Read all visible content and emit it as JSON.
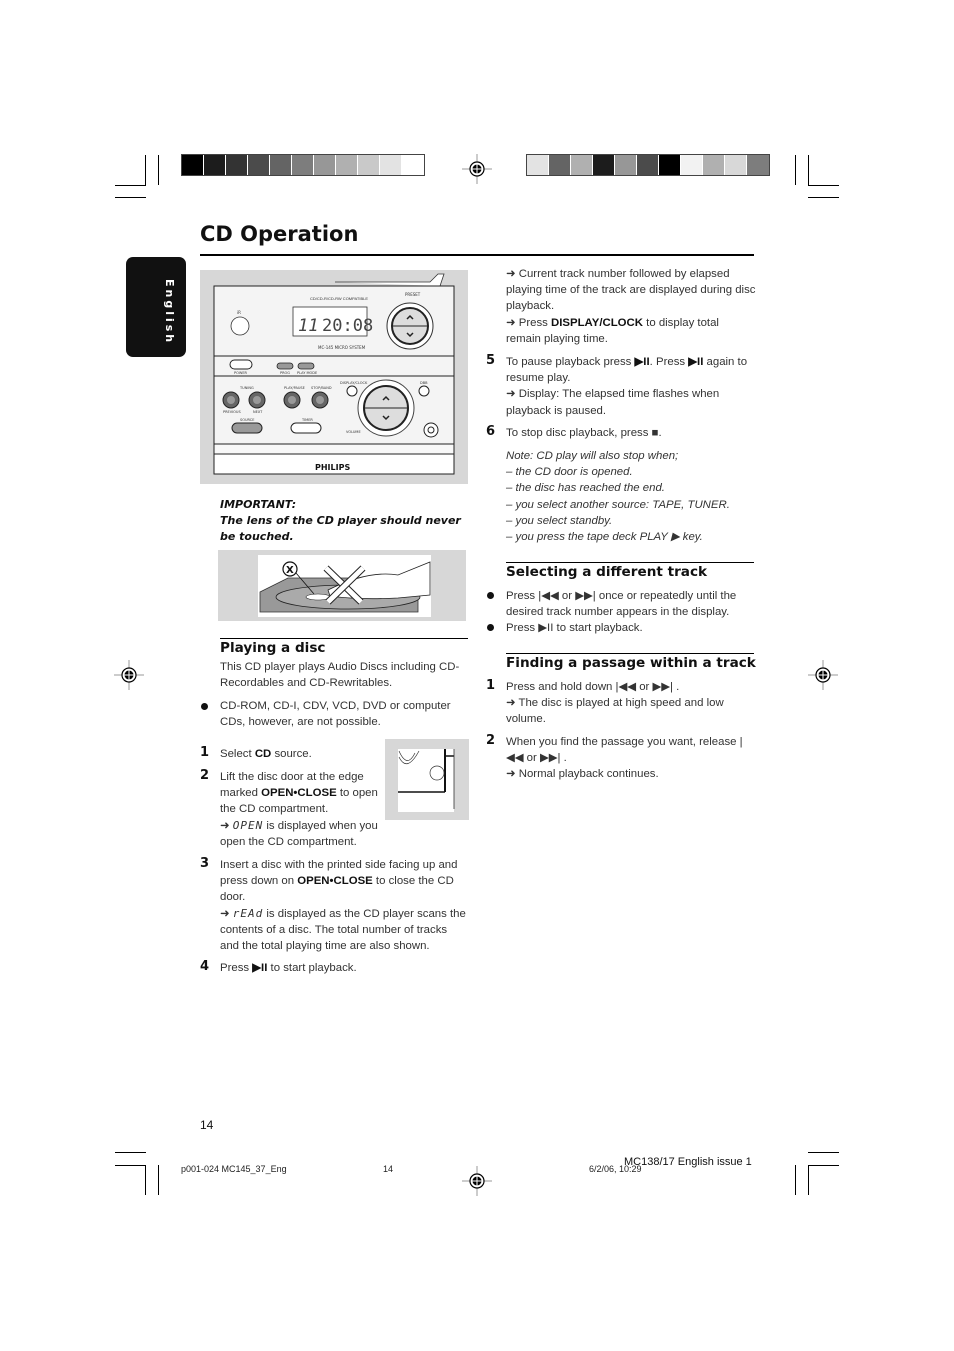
{
  "page": {
    "title": "CD Operation",
    "language_tab": "English",
    "page_number": "14"
  },
  "colorbars": {
    "left": [
      "#000000",
      "#1c1c1c",
      "#333333",
      "#4b4b4b",
      "#646464",
      "#7d7d7d",
      "#979797",
      "#b0b0b0",
      "#c9c9c9",
      "#e3e3e3",
      "#ffffff"
    ],
    "right": [
      "#e3e3e3",
      "#646464",
      "#b0b0b0",
      "#1c1c1c",
      "#979797",
      "#4b4b4b",
      "#000000",
      "#f2f2f2",
      "#b0b0b0",
      "#d8d8d8",
      "#7d7d7d"
    ]
  },
  "device_figure": {
    "display_track": "11",
    "display_time": "20:08",
    "brand": "PHILIPS",
    "labels": {
      "compat": "CD/CD-R/CD-RW COMPATIBLE",
      "preset": "PRESET",
      "system": "MC-145 MICRO SYSTEM",
      "power": "POWER",
      "prog": "PROG",
      "play_mode": "PLAY MODE",
      "tuning": "TUNING",
      "previous": "PREVIOUS",
      "next": "NEXT",
      "play_pause": "PLAY/PAUSE",
      "stop_band": "STOP/BAND",
      "display_clock": "DISPLAY/CLOCK",
      "dbb": "DBB",
      "source": "SOURCE",
      "timer": "TIMER",
      "volume": "VOLUME",
      "ir": "iR"
    }
  },
  "important": {
    "heading": "IMPORTANT:",
    "text": "The lens of the CD player should never be touched."
  },
  "playing_a_disc": {
    "heading": "Playing a disc",
    "intro": "This CD player plays Audio Discs including CD-Recordables and CD-Rewritables.",
    "bullet": "CD-ROM, CD-I, CDV, VCD, DVD or computer CDs, however, are not possible.",
    "steps": [
      {
        "num": "1",
        "pre": "Select ",
        "bold": "CD",
        "post": " source."
      },
      {
        "num": "2",
        "pre": "Lift the disc door at the edge marked ",
        "bold": "OPEN•CLOSE",
        "post": " to open the CD compartment.",
        "arrow_lcd": "OPEN",
        "arrow_text": " is displayed when you open the CD compartment."
      },
      {
        "num": "3",
        "pre": "Insert a disc with the printed side facing up and press down on ",
        "bold": "OPEN•CLOSE",
        "post": " to close the CD door.",
        "arrow_lcd": "rEAd",
        "arrow_text": " is displayed as the CD player scans the contents of a disc. The total number of tracks and the total playing time are also shown."
      },
      {
        "num": "4",
        "pre": "Press ",
        "bold": "▶II",
        "post": " to start playback."
      }
    ]
  },
  "right_column": {
    "arrow1": "Current track number followed by elapsed playing time of the track are displayed during disc playback.",
    "arrow2_pre": "Press ",
    "arrow2_bold": "DISPLAY/CLOCK",
    "arrow2_post": " to display total remain playing time.",
    "step5": {
      "num": "5",
      "text_a": "To pause playback press ",
      "icon": "▶II",
      "text_b": ".  Press ",
      "text_c": " again to resume play.",
      "arrow": "Display: The elapsed time  flashes when playback is paused."
    },
    "step6": {
      "num": "6",
      "text": "To stop disc playback, press ■."
    },
    "note": {
      "heading": "Note: CD play will also stop when;",
      "items": [
        "– the CD door is opened.",
        "– the disc has reached the end.",
        "– you select another source: TAPE, TUNER.",
        "– you select standby.",
        "– you press the tape deck PLAY ▶ key."
      ]
    }
  },
  "selecting_track": {
    "heading": "Selecting a different track",
    "bullets": [
      "Press |◀◀ or ▶▶|  once or repeatedly until the desired track number appears in the display.",
      "Press ▶II to start playback."
    ]
  },
  "finding_passage": {
    "heading": "Finding a passage within a track",
    "steps": [
      {
        "num": "1",
        "text": "Press and hold down |◀◀ or ▶▶| .",
        "arrow": "The disc is played at high speed and low volume."
      },
      {
        "num": "2",
        "text": "When you find the passage you want, release |◀◀ or ▶▶| .",
        "arrow": "Normal playback continues."
      }
    ]
  },
  "footer": {
    "file": "p001-024 MC145_37_Eng",
    "page": "14",
    "date": "6/2/06, 10:29",
    "issue": "MC138/17 English issue 1"
  }
}
